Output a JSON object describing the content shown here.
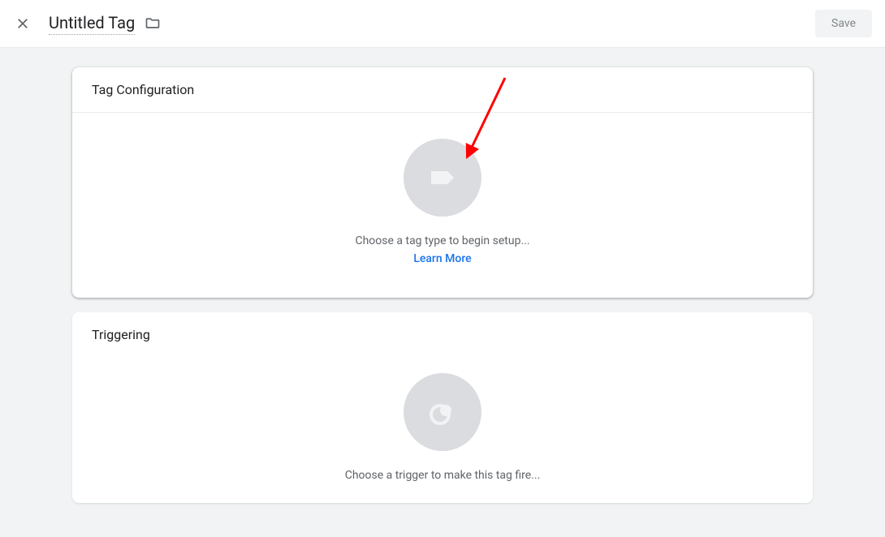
{
  "header": {
    "title": "Untitled Tag",
    "save_label": "Save"
  },
  "tag_config": {
    "title": "Tag Configuration",
    "placeholder_text": "Choose a tag type to begin setup...",
    "learn_more_label": "Learn More"
  },
  "triggering": {
    "title": "Triggering",
    "placeholder_text": "Choose a trigger to make this tag fire..."
  }
}
